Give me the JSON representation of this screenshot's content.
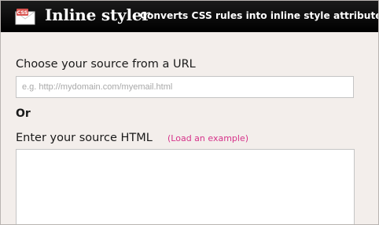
{
  "header": {
    "logo_icon": "css-envelope-icon",
    "logo_badge": "CSS",
    "title": "Inline styler",
    "tagline": "Converts CSS rules into inline style attributes"
  },
  "form": {
    "url_label": "Choose your source from a URL",
    "url_value": "",
    "url_placeholder": "e.g. http://mydomain.com/myemail.html",
    "or_label": "Or",
    "html_label": "Enter your source HTML",
    "load_example_text": "(Load an example)",
    "html_value": ""
  },
  "colors": {
    "header_bg": "#000000",
    "page_bg": "#f3eeeb",
    "link": "#d6338a",
    "logo_badge": "#d9534f"
  }
}
